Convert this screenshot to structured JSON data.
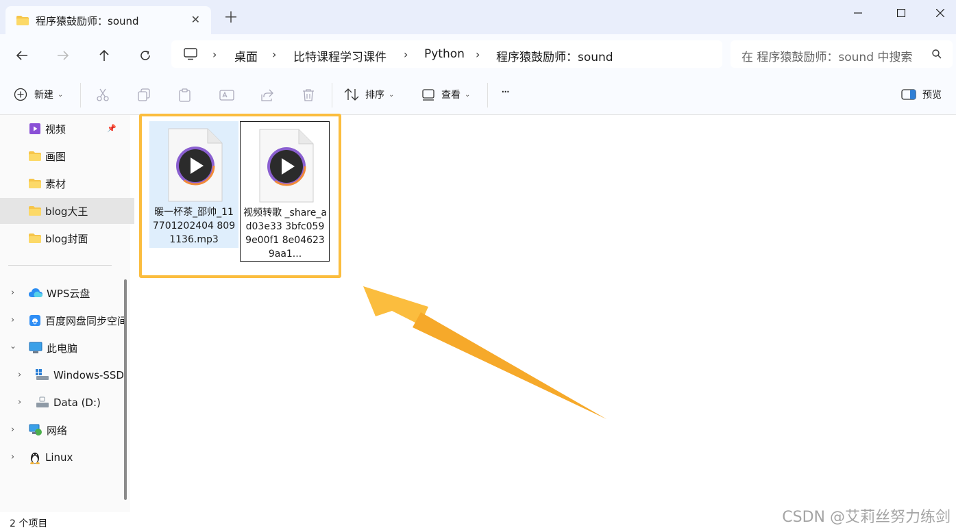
{
  "window": {
    "tab_title": "程序猿鼓励师：sound"
  },
  "breadcrumbs": [
    "桌面",
    "比特课程学习课件",
    "Python",
    "程序猿鼓励师：sound"
  ],
  "search": {
    "placeholder": "在 程序猿鼓励师：sound 中搜索"
  },
  "toolbar": {
    "new_label": "新建",
    "sort_label": "排序",
    "view_label": "查看",
    "more_label": "···",
    "preview_label": "预览"
  },
  "sidebar": {
    "quick": [
      {
        "label": "视频",
        "icon": "video-folder-icon",
        "pinned": true
      },
      {
        "label": "画图",
        "icon": "folder-icon"
      },
      {
        "label": "素材",
        "icon": "folder-icon"
      },
      {
        "label": "blog大王",
        "icon": "folder-icon",
        "selected": true
      },
      {
        "label": "blog封面",
        "icon": "folder-icon"
      }
    ],
    "tree": [
      {
        "label": "WPS云盘",
        "icon": "cloud-icon"
      },
      {
        "label": "百度网盘同步空间",
        "icon": "baidu-netdisk-icon"
      },
      {
        "label": "此电脑",
        "icon": "computer-icon",
        "expanded": true
      },
      {
        "label": "Windows-SSD",
        "icon": "drive-icon"
      },
      {
        "label": "Data (D:)",
        "icon": "drive-icon"
      },
      {
        "label": "网络",
        "icon": "network-icon"
      },
      {
        "label": "Linux",
        "icon": "linux-icon"
      }
    ]
  },
  "files": [
    {
      "name": "暖一杯茶_邵帅_1177012024048091136.mp3",
      "name_display": "暖一杯茶_邵帅_117701202404 8091136.mp3"
    },
    {
      "name": "视频转歌_share_ad03e333bfc0599e00f18e046239aa1...",
      "name_display": "视频转歌 _share_ad03e33 3bfc0599e00f1 8e046239aa1..."
    }
  ],
  "status": {
    "count": "2 个项目"
  },
  "watermark": "CSDN @艾莉丝努力练剑",
  "colors": {
    "highlight": "#fbbd3e",
    "arrow": "#fbbd3e"
  }
}
